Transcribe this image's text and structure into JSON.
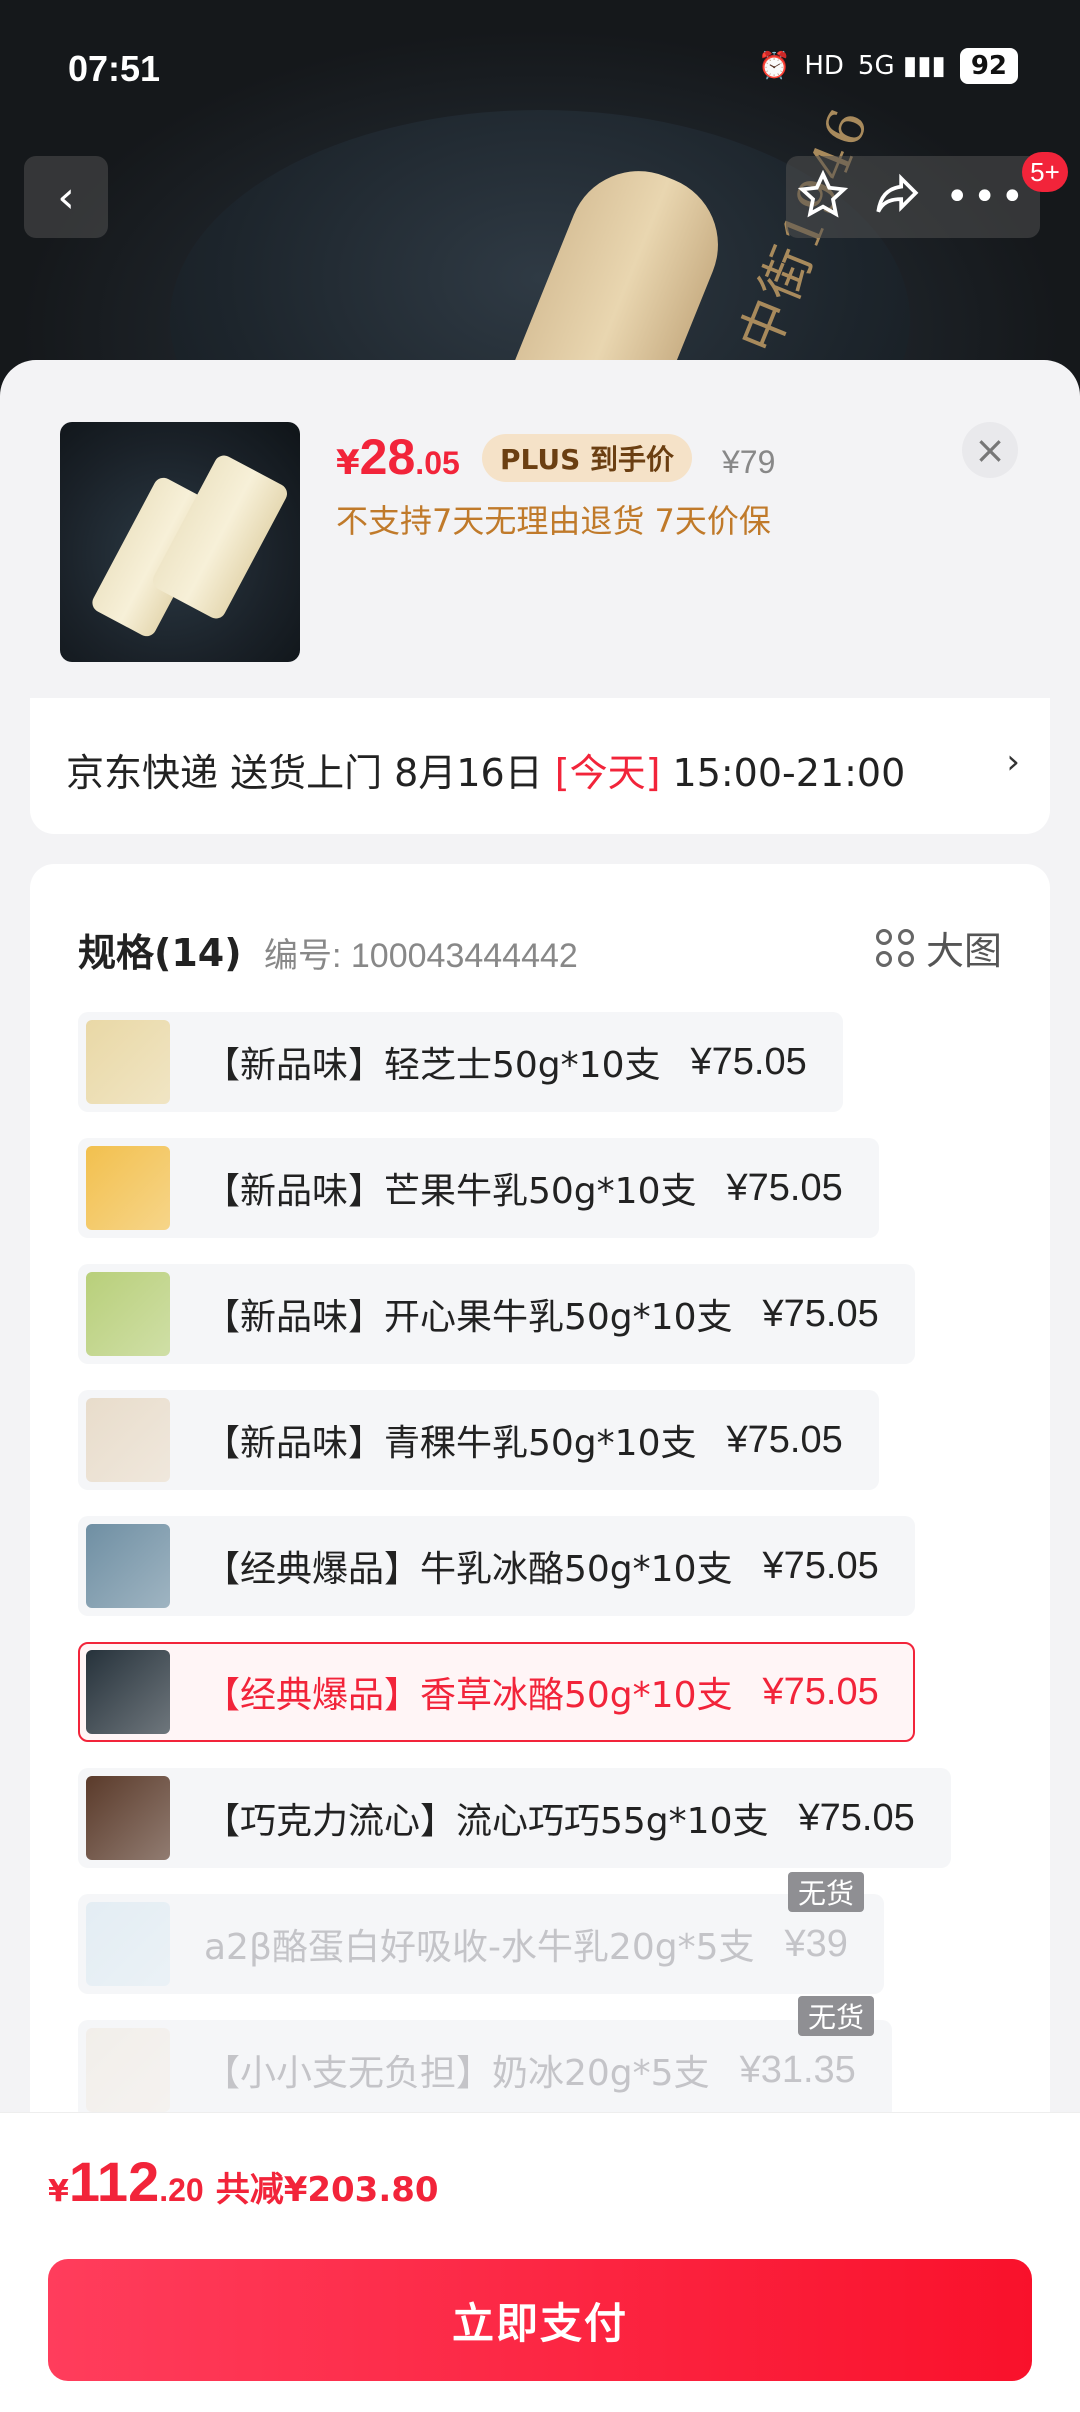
{
  "status_bar": {
    "time": "07:51",
    "network": "HD",
    "signal": "5G",
    "battery": "92"
  },
  "nav": {
    "back_icon": "chevron-left-icon",
    "badge": "5+"
  },
  "background": {
    "stick_text": "中街1946"
  },
  "product": {
    "price_symbol": "¥",
    "price_int": "28",
    "price_dec": ".05",
    "plus_label": "PLUS 到手价",
    "original_price": "¥79",
    "notice": "不支持7天无理由退货  7天价保"
  },
  "delivery": {
    "prefix": "京东快递 送货上门 8月16日 ",
    "today": "[今天]",
    "time": " 15:00-21:00",
    "arrow": "›"
  },
  "spec": {
    "title": "规格(14)",
    "code": "编号: 100043444442",
    "big_label": "大图",
    "options": [
      {
        "label": "【新品味】轻芝士50g*10支",
        "price": "¥75.05",
        "color": "#e9d8a6"
      },
      {
        "label": "【新品味】芒果牛乳50g*10支",
        "price": "¥75.05",
        "color": "#f2c04e"
      },
      {
        "label": "【新品味】开心果牛乳50g*10支",
        "price": "¥75.05",
        "color": "#b8cf7a"
      },
      {
        "label": "【新品味】青稞牛乳50g*10支",
        "price": "¥75.05",
        "color": "#e8dccb"
      },
      {
        "label": "【经典爆品】牛乳冰酪50g*10支",
        "price": "¥75.05",
        "color": "#6f8fa3"
      },
      {
        "label": "【经典爆品】香草冰酪50g*10支",
        "price": "¥75.05",
        "color": "#26323b"
      },
      {
        "label": "【巧克力流心】流心巧巧55g*10支",
        "price": "¥75.05",
        "color": "#5a3a2a"
      },
      {
        "label": "a2β酪蛋白好吸收-水牛乳20g*5支",
        "price": "¥39",
        "color": "#cfe3ef",
        "stock": "无货"
      },
      {
        "label": "【小小支无负担】奶冰20g*5支",
        "price": "¥31.35",
        "color": "#efe6da",
        "stock": "无货"
      }
    ]
  },
  "footer": {
    "total_symbol": "¥",
    "total_int": "112",
    "total_dec": ".20",
    "saving": "共减¥203.80",
    "pay_label": "立即支付"
  },
  "colors": {
    "accent": "#f2243a",
    "gold": "#c07a2a"
  }
}
